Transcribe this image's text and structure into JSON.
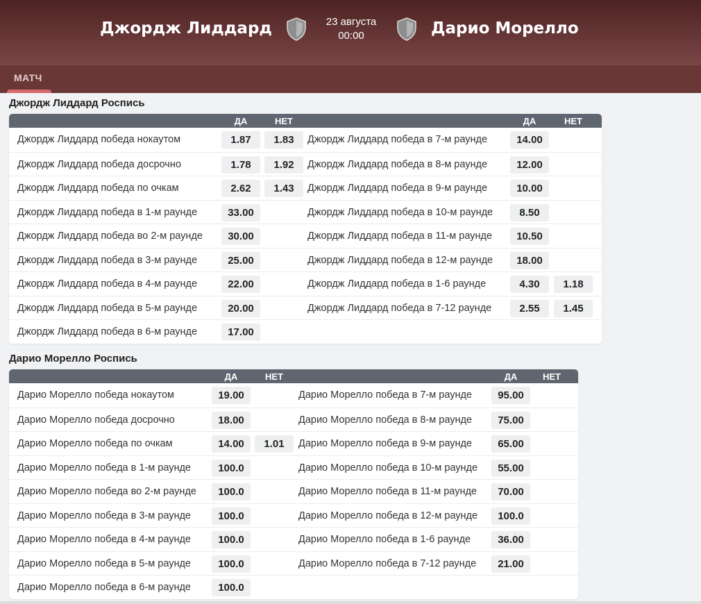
{
  "match": {
    "team1": "Джордж Лиддард",
    "team2": "Дарио Морелло",
    "date": "23 августа",
    "time": "00:00"
  },
  "tabs": {
    "active": "МАТЧ"
  },
  "colors": {
    "header_top": "#4e2323",
    "header_bottom": "#7a4646",
    "accent": "#d56a6a",
    "table_head": "#5f6670"
  },
  "icons": {
    "team1": "shield-icon",
    "team2": "shield-icon"
  },
  "sections": [
    {
      "title": "Джордж Лиддард Роспись",
      "headers": {
        "yes": "ДА",
        "no": "НЕТ"
      },
      "left": [
        {
          "label": "Джордж Лиддард победа нокаутом",
          "yes": "1.87",
          "no": "1.83"
        },
        {
          "label": "Джордж Лиддард победа досрочно",
          "yes": "1.78",
          "no": "1.92"
        },
        {
          "label": "Джордж Лиддард победа по очкам",
          "yes": "2.62",
          "no": "1.43"
        },
        {
          "label": "Джордж Лиддард победа в 1-м раунде",
          "yes": "33.00",
          "no": ""
        },
        {
          "label": "Джордж Лиддард победа во 2-м раунде",
          "yes": "30.00",
          "no": ""
        },
        {
          "label": "Джордж Лиддард победа в 3-м раунде",
          "yes": "25.00",
          "no": ""
        },
        {
          "label": "Джордж Лиддард победа в 4-м раунде",
          "yes": "22.00",
          "no": ""
        },
        {
          "label": "Джордж Лиддард победа в 5-м раунде",
          "yes": "20.00",
          "no": ""
        },
        {
          "label": "Джордж Лиддард победа в 6-м раунде",
          "yes": "17.00",
          "no": ""
        }
      ],
      "right": [
        {
          "label": "Джордж Лиддард победа в 7-м раунде",
          "yes": "14.00",
          "no": ""
        },
        {
          "label": "Джордж Лиддард победа в 8-м раунде",
          "yes": "12.00",
          "no": ""
        },
        {
          "label": "Джордж Лиддард победа в 9-м раунде",
          "yes": "10.00",
          "no": ""
        },
        {
          "label": "Джордж Лиддард победа в 10-м раунде",
          "yes": "8.50",
          "no": ""
        },
        {
          "label": "Джордж Лиддард победа в 11-м раунде",
          "yes": "10.50",
          "no": ""
        },
        {
          "label": "Джордж Лиддард победа в 12-м раунде",
          "yes": "18.00",
          "no": ""
        },
        {
          "label": "Джордж Лиддард победа в 1-6 раунде",
          "yes": "4.30",
          "no": "1.18"
        },
        {
          "label": "Джордж Лиддард победа в 7-12 раунде",
          "yes": "2.55",
          "no": "1.45"
        }
      ]
    },
    {
      "title": "Дарио Морелло Роспись",
      "headers": {
        "yes": "ДА",
        "no": "НЕТ"
      },
      "left": [
        {
          "label": "Дарио Морелло победа нокаутом",
          "yes": "19.00",
          "no": ""
        },
        {
          "label": "Дарио Морелло победа досрочно",
          "yes": "18.00",
          "no": ""
        },
        {
          "label": "Дарио Морелло победа по очкам",
          "yes": "14.00",
          "no": "1.01"
        },
        {
          "label": "Дарио Морелло победа в 1-м раунде",
          "yes": "100.0",
          "no": ""
        },
        {
          "label": "Дарио Морелло победа во 2-м раунде",
          "yes": "100.0",
          "no": ""
        },
        {
          "label": "Дарио Морелло победа в 3-м раунде",
          "yes": "100.0",
          "no": ""
        },
        {
          "label": "Дарио Морелло победа в 4-м раунде",
          "yes": "100.0",
          "no": ""
        },
        {
          "label": "Дарио Морелло победа в 5-м раунде",
          "yes": "100.0",
          "no": ""
        },
        {
          "label": "Дарио Морелло победа в 6-м раунде",
          "yes": "100.0",
          "no": ""
        }
      ],
      "right": [
        {
          "label": "Дарио Морелло победа в 7-м раунде",
          "yes": "95.00",
          "no": ""
        },
        {
          "label": "Дарио Морелло победа в 8-м раунде",
          "yes": "75.00",
          "no": ""
        },
        {
          "label": "Дарио Морелло победа в 9-м раунде",
          "yes": "65.00",
          "no": ""
        },
        {
          "label": "Дарио Морелло победа в 10-м раунде",
          "yes": "55.00",
          "no": ""
        },
        {
          "label": "Дарио Морелло победа в 11-м раунде",
          "yes": "70.00",
          "no": ""
        },
        {
          "label": "Дарио Морелло победа в 12-м раунде",
          "yes": "100.0",
          "no": ""
        },
        {
          "label": "Дарио Морелло победа в 1-6 раунде",
          "yes": "36.00",
          "no": ""
        },
        {
          "label": "Дарио Морелло победа в 7-12 раунде",
          "yes": "21.00",
          "no": ""
        }
      ]
    }
  ]
}
